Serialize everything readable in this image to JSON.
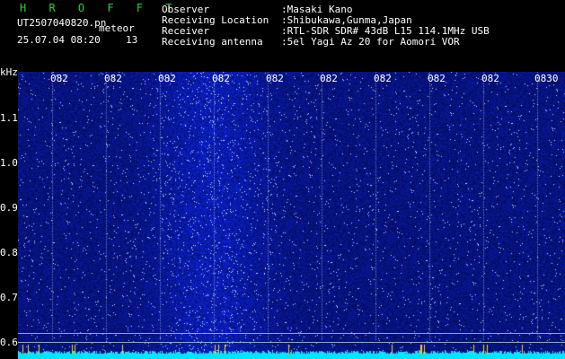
{
  "header": {
    "brand": "H R O F F T",
    "filename": "UT2507040820.pn",
    "mode": "meteor",
    "date_time": "25.07.04 08:20",
    "count": "13",
    "fields": [
      {
        "label": "Observer",
        "value": ":Masaki Kano"
      },
      {
        "label": "Receiving Location",
        "value": ":Shibukawa,Gunma,Japan"
      },
      {
        "label": "Receiver",
        "value": ":RTL-SDR SDR# 43dB L15 114.1MHz USB"
      },
      {
        "label": "Receiving antenna",
        "value": ":5el Yagi Az 20 for Aomori VOR"
      }
    ]
  },
  "axis": {
    "unit": "kHz",
    "y_ticks": [
      "1.1",
      "1.0",
      "0.9",
      "0.8",
      "0.7",
      "0.6"
    ],
    "x_ticks": [
      "082",
      "082",
      "082",
      "082",
      "082",
      "082",
      "082",
      "082",
      "082",
      "0830"
    ]
  },
  "colors": {
    "background": "#000000",
    "brand": "#2ecc40",
    "spectrum": "#1a2ea8",
    "noise_floor": "#00e5ff"
  }
}
